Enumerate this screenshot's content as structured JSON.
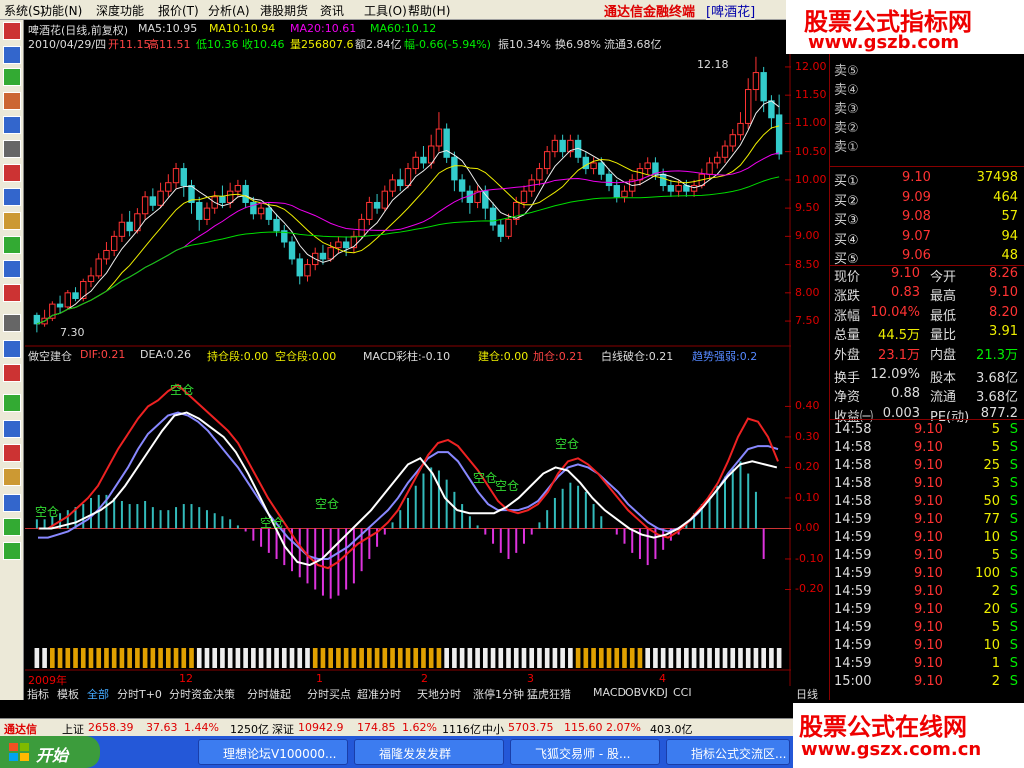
{
  "menu": {
    "items": [
      "系统",
      "功能",
      "深度功能",
      "报价",
      "分析",
      "港股期货",
      "资讯",
      "工具",
      "帮助"
    ],
    "keys": [
      "S",
      "N",
      "",
      "T",
      "A",
      "",
      "",
      "O",
      "H"
    ],
    "brand": "通达信金融终端",
    "stock": "[啤酒花]"
  },
  "watermark_top": {
    "line1": "股票公式指标网",
    "line2": "www.gszb.com"
  },
  "watermark_bottom": {
    "line1": "股票公式在线网",
    "line2": "www.gszx.com.cn"
  },
  "kline_header": {
    "title": "啤酒花(日线,前复权)",
    "ma5": "MA5:10.95",
    "ma10": "MA10:10.94",
    "ma20": "MA20:10.61",
    "ma60": "MA60:10.12",
    "date": "2010/04/29/四",
    "open_label": "开",
    "open": "11.15",
    "high_label": "高",
    "high": "11.51",
    "low_label": "低",
    "low": "10.36",
    "close_label": "收",
    "close": "10.46",
    "vol_label": "量",
    "vol": "256807.6",
    "amt_label": "额",
    "amt": "2.84亿",
    "range_label": "幅",
    "range": "-0.66(-5.94%)",
    "amp": "振10.34%",
    "turnover": "换6.98%",
    "float": "流通3.68亿"
  },
  "kline_annotations": {
    "high_mark": "12.18",
    "low_mark": "7.30"
  },
  "indicator_header": {
    "name": "做空建仓",
    "dif": "DIF:0.21",
    "dea": "DEA:0.26",
    "hold": "持仓段:0.00",
    "empty": "空仓段:0.00",
    "macd": "MACD彩柱:-0.10",
    "build": "建仓:0.00",
    "add": "加仓:0.21",
    "whiteline": "白线破仓:0.21",
    "trend": "趋势强弱:0.2"
  },
  "indicator_annotations": [
    "空仓",
    "空仓",
    "空仓",
    "空仓",
    "空仓",
    "空仓",
    "空仓"
  ],
  "x_axis": {
    "labels": [
      "2009年",
      "12",
      "1",
      "2",
      "3",
      "4"
    ],
    "period": "日线"
  },
  "bottom_tabs": [
    "指标",
    "模板",
    "全部",
    "分时T+0",
    "分时资金决策",
    "分时雄起",
    "分时买点",
    "超准分时",
    "天地分时",
    "涨停1分钟",
    "猛虎狂猎",
    "MACD",
    "OBV",
    "KDJ",
    "CCI"
  ],
  "quote": {
    "sell": [
      {
        "label": "卖⑤"
      },
      {
        "label": "卖④"
      },
      {
        "label": "卖③"
      },
      {
        "label": "卖②"
      },
      {
        "label": "卖①"
      }
    ],
    "buy": [
      {
        "label": "买①",
        "price": "9.10",
        "vol": "37498"
      },
      {
        "label": "买②",
        "price": "9.09",
        "vol": "464"
      },
      {
        "label": "买③",
        "price": "9.08",
        "vol": "57"
      },
      {
        "label": "买④",
        "price": "9.07",
        "vol": "94"
      },
      {
        "label": "买⑤",
        "price": "9.06",
        "vol": "48"
      }
    ],
    "stats": [
      {
        "l1": "现价",
        "v1": "9.10",
        "l2": "今开",
        "v2": "8.26"
      },
      {
        "l1": "涨跌",
        "v1": "0.83",
        "l2": "最高",
        "v2": "9.10"
      },
      {
        "l1": "涨幅",
        "v1": "10.04%",
        "l2": "最低",
        "v2": "8.20"
      },
      {
        "l1": "总量",
        "v1": "44.5万",
        "l2": "量比",
        "v2": "3.91"
      },
      {
        "l1": "外盘",
        "v1": "23.1万",
        "l2": "内盘",
        "v2": "21.3万"
      },
      {
        "l1": "换手",
        "v1": "12.09%",
        "l2": "股本",
        "v2": "3.68亿"
      },
      {
        "l1": "净资",
        "v1": "0.88",
        "l2": "流通",
        "v2": "3.68亿"
      },
      {
        "l1": "收益㈠",
        "v1": "0.003",
        "l2": "PE(动)",
        "v2": "877.2"
      }
    ],
    "ticks": [
      {
        "t": "14:58",
        "p": "9.10",
        "v": "5",
        "s": "S"
      },
      {
        "t": "14:58",
        "p": "9.10",
        "v": "5",
        "s": "S"
      },
      {
        "t": "14:58",
        "p": "9.10",
        "v": "25",
        "s": "S"
      },
      {
        "t": "14:58",
        "p": "9.10",
        "v": "3",
        "s": "S"
      },
      {
        "t": "14:58",
        "p": "9.10",
        "v": "50",
        "s": "S"
      },
      {
        "t": "14:59",
        "p": "9.10",
        "v": "77",
        "s": "S"
      },
      {
        "t": "14:59",
        "p": "9.10",
        "v": "10",
        "s": "S"
      },
      {
        "t": "14:59",
        "p": "9.10",
        "v": "5",
        "s": "S"
      },
      {
        "t": "14:59",
        "p": "9.10",
        "v": "100",
        "s": "S"
      },
      {
        "t": "14:59",
        "p": "9.10",
        "v": "2",
        "s": "S"
      },
      {
        "t": "14:59",
        "p": "9.10",
        "v": "20",
        "s": "S"
      },
      {
        "t": "14:59",
        "p": "9.10",
        "v": "5",
        "s": "S"
      },
      {
        "t": "14:59",
        "p": "9.10",
        "v": "10",
        "s": "S"
      },
      {
        "t": "14:59",
        "p": "9.10",
        "v": "1",
        "s": "S"
      },
      {
        "t": "15:00",
        "p": "9.10",
        "v": "2",
        "s": "S"
      }
    ]
  },
  "price_axis": [
    "12.00",
    "11.50",
    "11.00",
    "10.50",
    "10.00",
    "9.50",
    "9.00",
    "8.50",
    "8.00",
    "7.50"
  ],
  "ind_axis": [
    "0.40",
    "0.30",
    "0.20",
    "0.10",
    "0.00",
    "-0.10",
    "-0.20"
  ],
  "statusbar": {
    "app": "通达信",
    "sh_label": "上证",
    "sh": "2658.39",
    "sh_chg": "37.63",
    "sh_pct": "1.44%",
    "sh_amt": "1250亿",
    "sz_label": "深证",
    "sz": "10942.9",
    "sz_chg": "174.85",
    "sz_pct": "1.62%",
    "sz_amt": "1116亿",
    "zx_label": "中小",
    "zx": "5703.75",
    "zx_chg": "115.60",
    "zx_pct": "2.07%",
    "zx_amt": "403.0亿"
  },
  "taskbar": {
    "start": "开始",
    "tasks": [
      "理想论坛V100000...",
      "福隆发发发群",
      "飞狐交易师 - 股...",
      "指标公式交流区..."
    ]
  },
  "chart_data": {
    "type": "candlestick",
    "price_range": [
      7.2,
      12.3
    ],
    "indicator_range": [
      -0.3,
      0.48
    ],
    "candles": [
      [
        7.6,
        7.45,
        7.65,
        7.3
      ],
      [
        7.45,
        7.55,
        7.7,
        7.4
      ],
      [
        7.55,
        7.8,
        7.85,
        7.5
      ],
      [
        7.8,
        7.75,
        7.95,
        7.65
      ],
      [
        7.75,
        8.0,
        8.05,
        7.7
      ],
      [
        8.0,
        7.9,
        8.1,
        7.85
      ],
      [
        7.9,
        8.2,
        8.25,
        7.85
      ],
      [
        8.2,
        8.3,
        8.45,
        8.1
      ],
      [
        8.3,
        8.6,
        8.7,
        8.25
      ],
      [
        8.6,
        8.75,
        8.9,
        8.5
      ],
      [
        8.75,
        9.0,
        9.1,
        8.65
      ],
      [
        9.0,
        9.25,
        9.4,
        8.9
      ],
      [
        9.25,
        9.1,
        9.45,
        9.0
      ],
      [
        9.1,
        9.4,
        9.5,
        9.05
      ],
      [
        9.4,
        9.7,
        9.8,
        9.3
      ],
      [
        9.7,
        9.55,
        9.85,
        9.45
      ],
      [
        9.55,
        9.8,
        9.95,
        9.5
      ],
      [
        9.8,
        9.95,
        10.1,
        9.7
      ],
      [
        9.95,
        10.2,
        10.3,
        9.85
      ],
      [
        10.2,
        9.9,
        10.3,
        9.7
      ],
      [
        9.9,
        9.6,
        10.0,
        9.4
      ],
      [
        9.6,
        9.3,
        9.7,
        9.1
      ],
      [
        9.3,
        9.5,
        9.6,
        9.2
      ],
      [
        9.5,
        9.7,
        9.8,
        9.4
      ],
      [
        9.7,
        9.6,
        9.9,
        9.5
      ],
      [
        9.6,
        9.8,
        9.95,
        9.5
      ],
      [
        9.8,
        9.9,
        10.0,
        9.7
      ],
      [
        9.9,
        9.6,
        10.0,
        9.5
      ],
      [
        9.6,
        9.4,
        9.7,
        9.3
      ],
      [
        9.4,
        9.5,
        9.6,
        9.3
      ],
      [
        9.5,
        9.3,
        9.6,
        9.2
      ],
      [
        9.3,
        9.1,
        9.4,
        9.0
      ],
      [
        9.1,
        8.9,
        9.2,
        8.8
      ],
      [
        8.9,
        8.6,
        9.0,
        8.5
      ],
      [
        8.6,
        8.3,
        8.7,
        8.15
      ],
      [
        8.3,
        8.5,
        8.6,
        8.2
      ],
      [
        8.5,
        8.7,
        8.8,
        8.4
      ],
      [
        8.7,
        8.6,
        8.85,
        8.5
      ],
      [
        8.6,
        8.8,
        8.9,
        8.55
      ],
      [
        8.8,
        8.9,
        9.0,
        8.7
      ],
      [
        8.9,
        8.8,
        9.0,
        8.65
      ],
      [
        8.8,
        9.0,
        9.1,
        8.7
      ],
      [
        9.0,
        9.3,
        9.4,
        8.95
      ],
      [
        9.3,
        9.6,
        9.7,
        9.2
      ],
      [
        9.6,
        9.5,
        9.75,
        9.4
      ],
      [
        9.5,
        9.8,
        9.9,
        9.45
      ],
      [
        9.8,
        10.0,
        10.1,
        9.7
      ],
      [
        10.0,
        9.9,
        10.2,
        9.8
      ],
      [
        9.9,
        10.2,
        10.3,
        9.85
      ],
      [
        10.2,
        10.4,
        10.5,
        10.1
      ],
      [
        10.4,
        10.3,
        10.6,
        10.2
      ],
      [
        10.3,
        10.6,
        10.8,
        10.2
      ],
      [
        10.6,
        10.9,
        11.2,
        10.5
      ],
      [
        10.9,
        10.4,
        11.0,
        10.3
      ],
      [
        10.4,
        10.0,
        10.5,
        9.8
      ],
      [
        10.0,
        9.8,
        10.1,
        9.6
      ],
      [
        9.8,
        9.6,
        9.9,
        9.4
      ],
      [
        9.6,
        9.8,
        9.9,
        9.5
      ],
      [
        9.8,
        9.5,
        9.9,
        9.3
      ],
      [
        9.5,
        9.2,
        9.6,
        9.1
      ],
      [
        9.2,
        9.0,
        9.3,
        8.9
      ],
      [
        9.0,
        9.3,
        9.4,
        8.95
      ],
      [
        9.3,
        9.6,
        9.7,
        9.2
      ],
      [
        9.6,
        9.8,
        9.9,
        9.5
      ],
      [
        9.8,
        10.0,
        10.1,
        9.7
      ],
      [
        10.0,
        10.2,
        10.3,
        9.9
      ],
      [
        10.2,
        10.5,
        10.6,
        10.1
      ],
      [
        10.5,
        10.7,
        10.8,
        10.4
      ],
      [
        10.7,
        10.5,
        10.8,
        10.4
      ],
      [
        10.5,
        10.7,
        10.8,
        10.4
      ],
      [
        10.7,
        10.4,
        10.8,
        10.3
      ],
      [
        10.4,
        10.2,
        10.5,
        10.1
      ],
      [
        10.2,
        10.3,
        10.4,
        10.1
      ],
      [
        10.3,
        10.1,
        10.4,
        10.0
      ],
      [
        10.1,
        9.9,
        10.2,
        9.8
      ],
      [
        9.9,
        9.7,
        10.0,
        9.6
      ],
      [
        9.7,
        9.8,
        9.9,
        9.6
      ],
      [
        9.8,
        10.0,
        10.1,
        9.7
      ],
      [
        10.0,
        10.2,
        10.3,
        9.9
      ],
      [
        10.2,
        10.3,
        10.4,
        10.1
      ],
      [
        10.3,
        10.1,
        10.4,
        10.0
      ],
      [
        10.1,
        9.9,
        10.2,
        9.8
      ],
      [
        9.9,
        9.8,
        10.0,
        9.7
      ],
      [
        9.8,
        9.9,
        10.0,
        9.7
      ],
      [
        9.9,
        9.8,
        10.0,
        9.7
      ],
      [
        9.8,
        9.9,
        10.0,
        9.7
      ],
      [
        9.9,
        10.1,
        10.2,
        9.85
      ],
      [
        10.1,
        10.3,
        10.4,
        10.0
      ],
      [
        10.3,
        10.4,
        10.5,
        10.2
      ],
      [
        10.4,
        10.6,
        10.7,
        10.3
      ],
      [
        10.6,
        10.8,
        10.9,
        10.5
      ],
      [
        10.8,
        11.0,
        11.2,
        10.7
      ],
      [
        11.0,
        11.6,
        11.8,
        10.9
      ],
      [
        11.6,
        11.9,
        12.18,
        11.4
      ],
      [
        11.9,
        11.4,
        12.0,
        11.2
      ],
      [
        11.4,
        11.1,
        11.5,
        10.9
      ],
      [
        11.15,
        10.46,
        11.51,
        10.36
      ]
    ],
    "dif": [
      0.0,
      0.0,
      0.02,
      0.04,
      0.07,
      0.1,
      0.14,
      0.2,
      0.26,
      0.31,
      0.36,
      0.4,
      0.42,
      0.45,
      0.47,
      0.44,
      0.41,
      0.38,
      0.35,
      0.32,
      0.28,
      0.22,
      0.16,
      0.1,
      0.05,
      0.0,
      -0.05,
      -0.09,
      -0.12,
      -0.13,
      -0.11,
      -0.08,
      -0.05,
      -0.03,
      -0.01,
      0.02,
      0.06,
      0.12,
      0.18,
      0.24,
      0.28,
      0.29,
      0.27,
      0.23,
      0.19,
      0.14,
      0.09,
      0.06,
      0.05,
      0.06,
      0.08,
      0.12,
      0.18,
      0.22,
      0.23,
      0.21,
      0.18,
      0.14,
      0.1,
      0.06,
      0.03,
      0.0,
      -0.02,
      -0.03,
      -0.01,
      0.02,
      0.06,
      0.1,
      0.15,
      0.22,
      0.3,
      0.36,
      0.35,
      0.3,
      0.22
    ],
    "dea": [
      -0.03,
      -0.03,
      -0.02,
      -0.01,
      0.01,
      0.03,
      0.06,
      0.1,
      0.15,
      0.2,
      0.26,
      0.31,
      0.34,
      0.37,
      0.38,
      0.37,
      0.35,
      0.32,
      0.28,
      0.24,
      0.2,
      0.15,
      0.1,
      0.05,
      0.01,
      -0.03,
      -0.06,
      -0.09,
      -0.1,
      -0.1,
      -0.08,
      -0.06,
      -0.03,
      0.0,
      0.03,
      0.06,
      0.1,
      0.15,
      0.19,
      0.23,
      0.25,
      0.25,
      0.22,
      0.17,
      0.12,
      0.08,
      0.06,
      0.06,
      0.06,
      0.07,
      0.09,
      0.13,
      0.17,
      0.2,
      0.21,
      0.2,
      0.18,
      0.15,
      0.12,
      0.08,
      0.05,
      0.02,
      0.0,
      -0.01,
      0.0,
      0.02,
      0.05,
      0.09,
      0.13,
      0.18,
      0.22,
      0.26,
      0.27,
      0.27,
      0.26
    ],
    "white": [
      0.0,
      0.0,
      0.01,
      0.02,
      0.04,
      0.06,
      0.09,
      0.14,
      0.2,
      0.26,
      0.32,
      0.37,
      0.38,
      0.36,
      0.33,
      0.3,
      0.25,
      0.18,
      0.1,
      0.02,
      -0.06,
      -0.11,
      -0.12,
      -0.1,
      -0.06,
      -0.02,
      0.02,
      0.06,
      0.11,
      0.16,
      0.21,
      0.23,
      0.18,
      0.1,
      0.06,
      0.05,
      0.05,
      0.05,
      0.07,
      0.1,
      0.14,
      0.18,
      0.2,
      0.19,
      0.15,
      0.1,
      0.06,
      0.03,
      0.0,
      -0.02,
      -0.03,
      -0.02,
      0.0,
      0.03,
      0.07,
      0.12,
      0.17,
      0.21,
      0.22,
      0.21,
      0.2
    ],
    "macd": [
      0.03,
      0.03,
      0.04,
      0.05,
      0.06,
      0.07,
      0.08,
      0.1,
      0.11,
      0.11,
      0.1,
      0.09,
      0.08,
      0.08,
      0.09,
      0.07,
      0.06,
      0.06,
      0.07,
      0.08,
      0.08,
      0.07,
      0.06,
      0.05,
      0.04,
      0.03,
      0.01,
      -0.01,
      -0.04,
      -0.06,
      -0.08,
      -0.1,
      -0.12,
      -0.14,
      -0.16,
      -0.18,
      -0.2,
      -0.22,
      -0.23,
      -0.22,
      -0.2,
      -0.18,
      -0.14,
      -0.1,
      -0.06,
      -0.02,
      0.02,
      0.06,
      0.1,
      0.14,
      0.18,
      0.2,
      0.19,
      0.16,
      0.12,
      0.08,
      0.04,
      0.01,
      -0.02,
      -0.05,
      -0.08,
      -0.1,
      -0.08,
      -0.05,
      -0.02,
      0.02,
      0.06,
      0.1,
      0.13,
      0.15,
      0.14,
      0.12,
      0.08,
      0.04,
      0.0,
      -0.02,
      -0.05,
      -0.08,
      -0.1,
      -0.12,
      -0.1,
      -0.07,
      -0.04,
      -0.02,
      0.02,
      0.05,
      0.08,
      0.11,
      0.14,
      0.17,
      0.2,
      0.22,
      0.18,
      0.12,
      -0.1
    ]
  }
}
